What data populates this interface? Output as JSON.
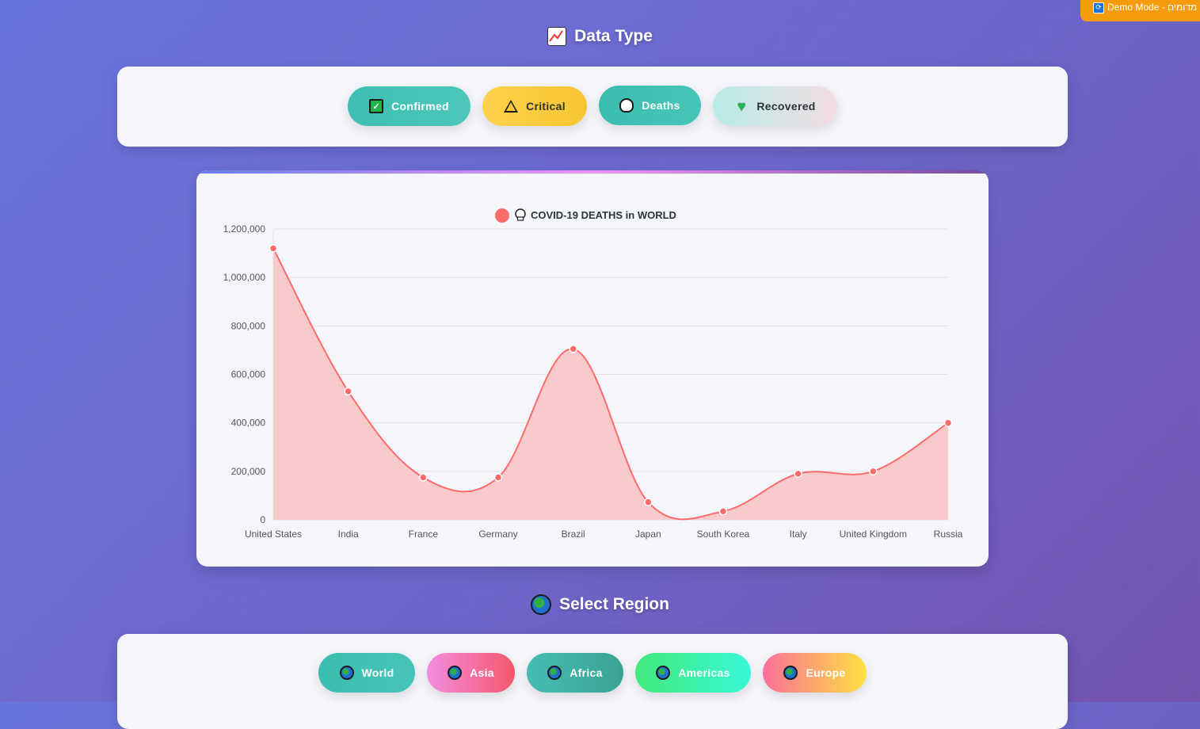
{
  "demo_badge": "Demo Mode - מדומים",
  "data_type": {
    "title": "Data Type",
    "buttons": [
      {
        "label": "Confirmed",
        "icon": "check-icon",
        "gradient": [
          "#3fbfb1",
          "#4cc7ba"
        ],
        "text_color": "#ffffff"
      },
      {
        "label": "Critical",
        "icon": "warning-icon",
        "gradient": [
          "#ffd24d",
          "#f7c530"
        ],
        "text_color": "#2d3436"
      },
      {
        "label": "Deaths",
        "icon": "skull-icon",
        "gradient": [
          "#3bbdb0",
          "#47c4b7"
        ],
        "text_color": "#ffffff"
      },
      {
        "label": "Recovered",
        "icon": "heart-icon",
        "gradient": [
          "#b7ebe6",
          "#f4dde3"
        ],
        "text_color": "#2d3436"
      }
    ],
    "active": "Deaths"
  },
  "chart_data": {
    "type": "line",
    "title": "COVID-19 DEATHS in WORLD",
    "legend_placement": "top-center",
    "legend": [
      {
        "label": "COVID-19 DEATHS in WORLD",
        "icon": "skull-icon",
        "color": "#ff6b6b"
      }
    ],
    "categories": [
      "United States",
      "India",
      "France",
      "Germany",
      "Brazil",
      "Japan",
      "South Korea",
      "Italy",
      "United Kingdom",
      "Russia"
    ],
    "series": [
      {
        "name": "COVID-19 DEATHS in WORLD",
        "values": [
          1120000,
          530000,
          175000,
          175000,
          705000,
          73000,
          35000,
          190000,
          200000,
          400000
        ],
        "color": "#ff6b6b",
        "fill": "#f9cacc"
      }
    ],
    "ylim": [
      0,
      1200000
    ],
    "yticks": [
      "0",
      "200,000",
      "400,000",
      "600,000",
      "800,000",
      "1,000,000",
      "1,200,000"
    ],
    "grid": true,
    "smooth": true
  },
  "region": {
    "title": "Select Region",
    "buttons": [
      {
        "label": "World",
        "gradient": [
          "#3bbdb0",
          "#47c4b7"
        ]
      },
      {
        "label": "Asia",
        "gradient": [
          "#f38de0",
          "#f5576c"
        ]
      },
      {
        "label": "Africa",
        "gradient": [
          "#46bdb2",
          "#3aa393"
        ]
      },
      {
        "label": "Americas",
        "gradient": [
          "#43e97b",
          "#38f9d7"
        ]
      },
      {
        "label": "Europe",
        "gradient": [
          "#fa709a",
          "#fee140"
        ]
      }
    ],
    "active": "World"
  }
}
